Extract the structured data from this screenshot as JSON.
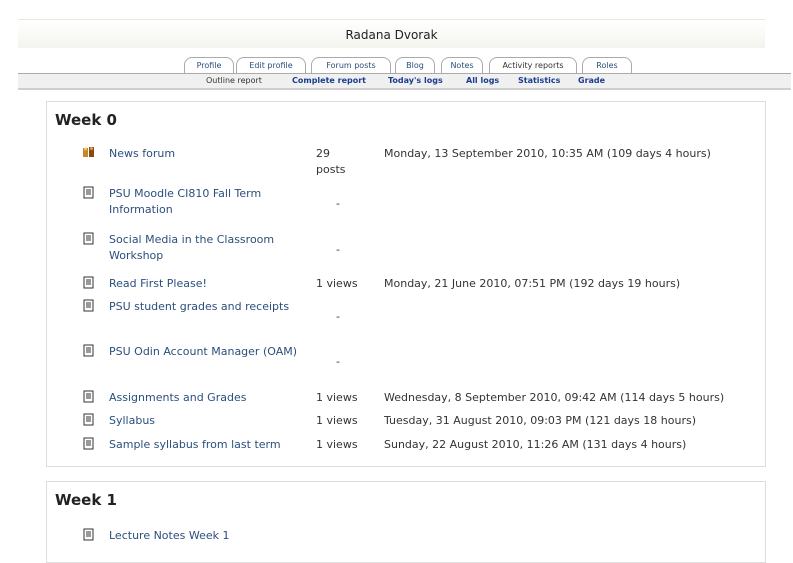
{
  "user_name": "Radana Dvorak",
  "tabs": [
    "Profile",
    "Edit profile",
    "Forum posts",
    "Blog",
    "Notes",
    "Activity reports",
    "Roles"
  ],
  "subtabs": [
    "Outline report",
    "Complete report",
    "Today's logs",
    "All logs",
    "Statistics",
    "Grade"
  ],
  "week0": {
    "title": "Week 0",
    "rows": [
      {
        "icon": "forum-icon",
        "name": "News forum",
        "views": "29 posts",
        "date": "Monday, 13 September 2010, 10:35 AM (109 days 4 hours)"
      },
      {
        "icon": "page-icon",
        "name": "PSU Moodle CI810 Fall Term Information",
        "views": "-",
        "date": ""
      },
      {
        "icon": "page-icon",
        "name": "Social Media in the Classroom Workshop",
        "views": "-",
        "date": ""
      },
      {
        "icon": "page-icon",
        "name": "Read First Please!",
        "views": "1 views",
        "date": "Monday, 21 June 2010, 07:51 PM (192 days 19 hours)"
      },
      {
        "icon": "page-icon",
        "name": "PSU student grades and receipts",
        "views": "-",
        "date": ""
      },
      {
        "icon": "page-icon",
        "name": "PSU Odin Account Manager (OAM)",
        "views": "-",
        "date": ""
      },
      {
        "icon": "page-icon",
        "name": "Assignments and Grades",
        "views": "1 views",
        "date": "Wednesday, 8 September 2010, 09:42 AM (114 days 5 hours)"
      },
      {
        "icon": "page-icon",
        "name": "Syllabus",
        "views": "1 views",
        "date": "Tuesday, 31 August 2010, 09:03 PM (121 days 18 hours)"
      },
      {
        "icon": "page-icon",
        "name": "Sample syllabus from last term",
        "views": "1 views",
        "date": "Sunday, 22 August 2010, 11:26 AM (131 days 4 hours)"
      }
    ]
  },
  "week1": {
    "title": "Week 1",
    "rows": [
      {
        "icon": "page-icon",
        "name": "Lecture Notes Week 1",
        "views": "",
        "date": ""
      }
    ]
  }
}
